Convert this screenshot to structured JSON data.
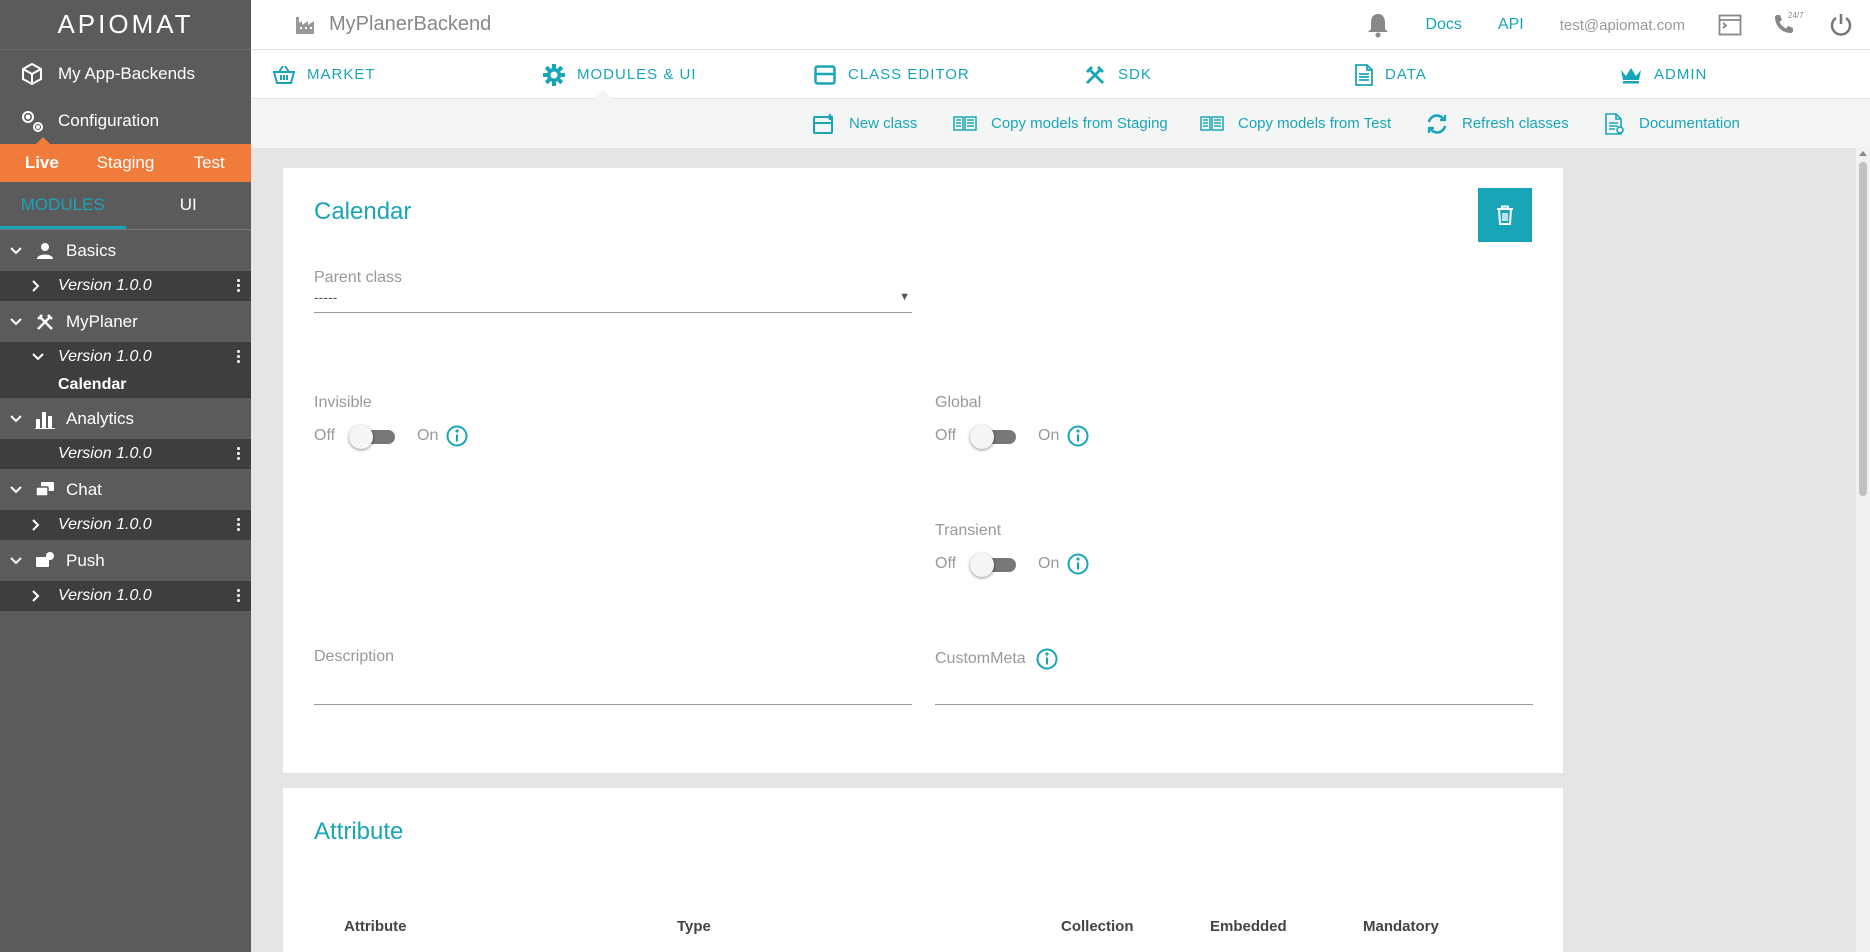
{
  "logo": "APIOMAT",
  "sidebar": {
    "links": [
      {
        "label": "My App-Backends",
        "icon": "cube-icon"
      },
      {
        "label": "Configuration",
        "icon": "gears-icon"
      }
    ],
    "environments": [
      "Live",
      "Staging",
      "Test"
    ],
    "tabs": [
      "MODULES",
      "UI"
    ],
    "modules": [
      {
        "name": "Basics",
        "icon": "user-icon",
        "version": "Version 1.0.0"
      },
      {
        "name": "MyPlaner",
        "icon": "tools-icon",
        "version": "Version 1.0.0",
        "class": "Calendar"
      },
      {
        "name": "Analytics",
        "icon": "chart-icon",
        "version": "Version 1.0.0"
      },
      {
        "name": "Chat",
        "icon": "chat-icon",
        "version": "Version 1.0.0"
      },
      {
        "name": "Push",
        "icon": "push-icon",
        "version": "Version 1.0.0"
      }
    ]
  },
  "header": {
    "app_name": "MyPlanerBackend",
    "docs": "Docs",
    "api": "API",
    "email": "test@apiomat.com",
    "support": "24/7"
  },
  "nav": [
    "MARKET",
    "MODULES & UI",
    "CLASS EDITOR",
    "SDK",
    "DATA",
    "ADMIN"
  ],
  "subnav": [
    "New class",
    "Copy models from Staging",
    "Copy models from Test",
    "Refresh classes",
    "Documentation"
  ],
  "class_card": {
    "title": "Calendar",
    "parent_class_label": "Parent class",
    "parent_class_value": "-----",
    "invisible_label": "Invisible",
    "global_label": "Global",
    "transient_label": "Transient",
    "off": "Off",
    "on": "On",
    "description_label": "Description",
    "custom_meta_label": "CustomMeta"
  },
  "attribute_card": {
    "title": "Attribute",
    "columns": [
      "Attribute",
      "Type",
      "Collection",
      "Embedded",
      "Mandatory"
    ]
  },
  "colors": {
    "accent": "#19a5b8",
    "env_bar": "#f07b3b",
    "sidebar": "#5b5b5b"
  }
}
